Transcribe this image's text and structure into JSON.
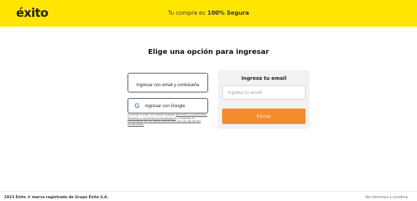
{
  "header": {
    "logo": "éxito",
    "secure_prefix": "Tu compra es",
    "secure_emphasis": "100% Segura",
    "background_color": "#ffe600"
  },
  "main": {
    "title": "Elige una opción para ingresar",
    "email_password_button": "Ingresar con email y contraseña",
    "google_button": "Ingresar con Google",
    "google_icon": "google-icon",
    "legal": {
      "text_start": "Al iniciar o crear un cuenta aceptas",
      "link_terms": "términos y condiciones, términos y condiciones marketplace",
      "text_mid": "y autorizas el",
      "link_data": "tratamiento de tus datos personales con las siguientes condiciones."
    }
  },
  "email_panel": {
    "title": "Ingresa tu email",
    "input_placeholder": "Ingresa tu email",
    "input_value": "",
    "send_button": "Enviar",
    "accent_color": "#f48b2d"
  },
  "footer": {
    "copyright": "2023 Éxito ® marca registrada de Grupo Éxito S.A.",
    "terms_link": "Ver términos y condicio"
  }
}
